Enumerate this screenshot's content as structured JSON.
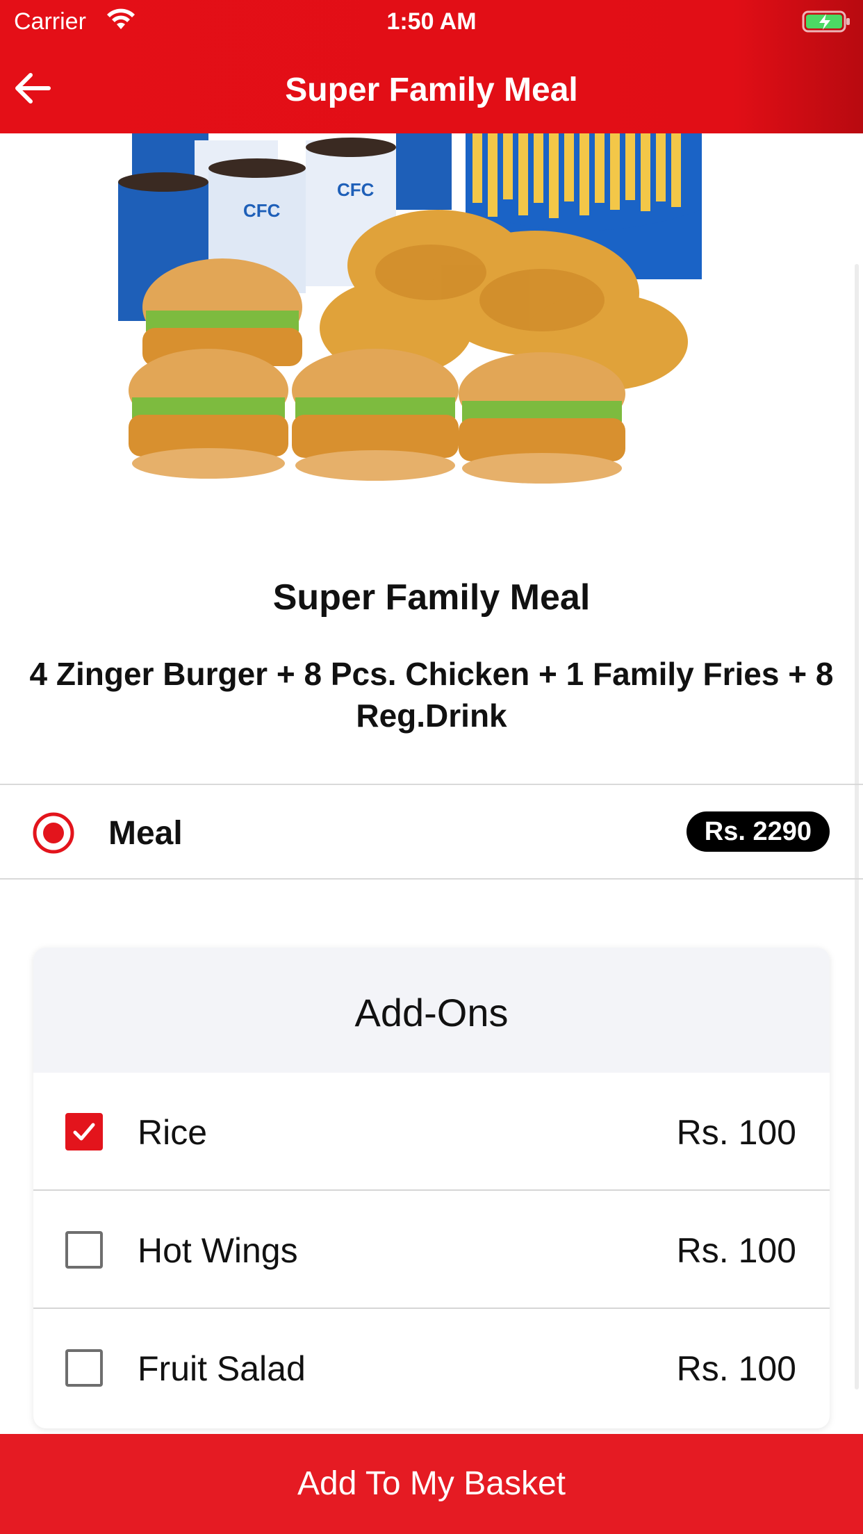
{
  "status_bar": {
    "carrier": "Carrier",
    "time": "1:50 AM"
  },
  "header": {
    "title": "Super Family Meal",
    "back_icon": "arrow-left-icon",
    "background_color": "#e40f17"
  },
  "product": {
    "title": "Super Family Meal",
    "description": "4 Zinger Burger + 8 Pcs. Chicken + 1 Family Fries + 8 Reg.Drink",
    "image_brand_text": "CFC"
  },
  "options": [
    {
      "label": "Meal",
      "price": "Rs. 2290",
      "selected": true
    }
  ],
  "addons": {
    "title": "Add-Ons",
    "items": [
      {
        "label": "Rice",
        "price": "Rs. 100",
        "checked": true
      },
      {
        "label": "Hot Wings",
        "price": "Rs. 100",
        "checked": false
      },
      {
        "label": "Fruit Salad",
        "price": "Rs. 100",
        "checked": false
      }
    ]
  },
  "footer": {
    "button_label": "Add To My Basket",
    "button_color": "#e51b23"
  }
}
